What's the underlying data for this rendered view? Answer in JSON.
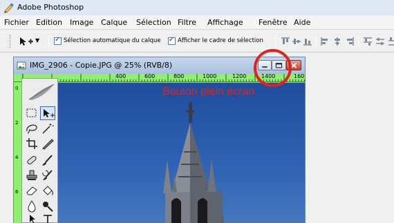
{
  "app": {
    "title": "Adobe Photoshop",
    "icon": "photoshop-icon"
  },
  "menu": {
    "items": [
      "Fichier",
      "Edition",
      "Image",
      "Calque",
      "Sélection",
      "Filtre",
      "Affichage",
      "Fenêtre",
      "Aide"
    ]
  },
  "options": {
    "auto_select_label": "Sélection automatique du calque",
    "auto_select_checked": true,
    "show_bounds_label": "Afficher le cadre de sélection",
    "show_bounds_checked": true
  },
  "document": {
    "title": "IMG_2906 - Copie.JPG @ 25% (RVB/8)",
    "ruler_top_ticks": [
      "400",
      "600",
      "800",
      "1000",
      "1200",
      "1400",
      "160"
    ],
    "ruler_left_ticks": [
      "0",
      "2",
      "4",
      "6"
    ]
  },
  "annotation": {
    "text": "Bouton plein écran",
    "color": "#e0231d"
  },
  "colors": {
    "ruler": "#8fef6f",
    "sky": "#2f63b3",
    "annotation": "#e0231d"
  }
}
